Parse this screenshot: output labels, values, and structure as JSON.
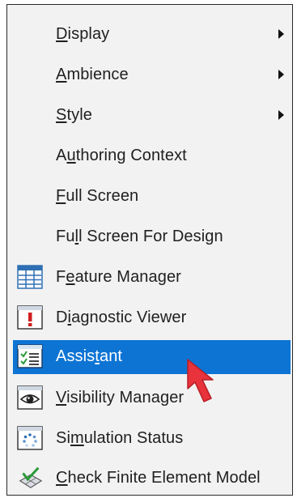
{
  "menu": {
    "items": [
      {
        "pre": "",
        "key": "D",
        "post": "isplay"
      },
      {
        "pre": "",
        "key": "A",
        "post": "mbience"
      },
      {
        "pre": "",
        "key": "S",
        "post": "tyle"
      },
      {
        "pre": "A",
        "key": "u",
        "post": "thoring Context"
      },
      {
        "pre": "",
        "key": "F",
        "post": "ull Screen"
      },
      {
        "pre": "Fu",
        "key": "l",
        "post": "l Screen For Design"
      },
      {
        "pre": "F",
        "key": "e",
        "post": "ature Manager"
      },
      {
        "pre": "D",
        "key": "i",
        "post": "agnostic Viewer"
      },
      {
        "pre": "Assis",
        "key": "t",
        "post": "ant"
      },
      {
        "pre": "",
        "key": "V",
        "post": "isibility Manager"
      },
      {
        "pre": "Si",
        "key": "m",
        "post": "ulation Status"
      },
      {
        "pre": "",
        "key": "C",
        "post": "heck Finite Element Model"
      }
    ],
    "selected_label": "Assistant"
  },
  "icons": {
    "feature_manager": "feature-manager-icon",
    "diagnostic_viewer": "diagnostic-viewer-icon",
    "assistant": "assistant-icon",
    "visibility_manager": "visibility-manager-icon",
    "simulation_status": "simulation-status-icon",
    "check_fem": "check-finite-element-model-icon",
    "submenu_arrow": "submenu-arrow-icon",
    "cursor": "mouse-pointer-icon"
  },
  "colors": {
    "selection": "#0d74d4",
    "menu_bg": "#f2f2f2",
    "text": "#202020",
    "pointer": "#e8323c"
  }
}
